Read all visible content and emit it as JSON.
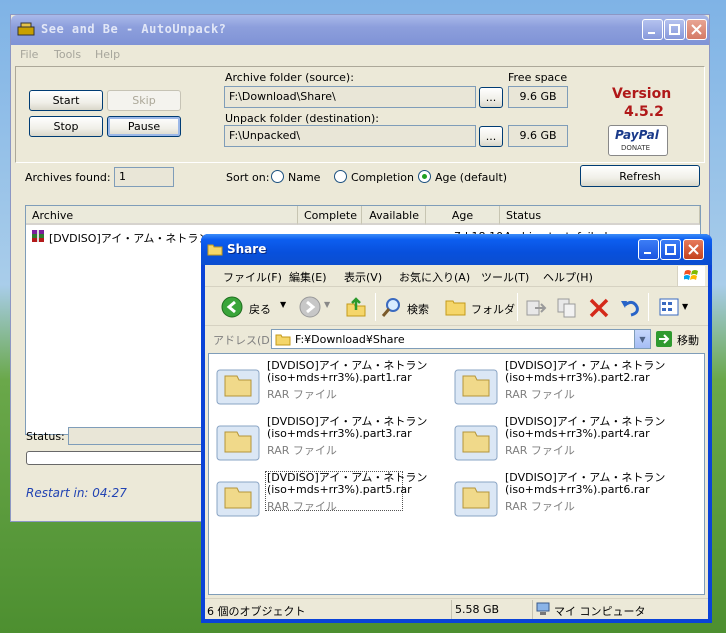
{
  "autounpack": {
    "title": "See and Be - AutoUnpack?",
    "menu": [
      "File",
      "Tools",
      "Help"
    ],
    "buttons": {
      "start": "Start",
      "skip": "Skip",
      "stop": "Stop",
      "pause": "Pause",
      "browse": "...",
      "refresh": "Refresh"
    },
    "archive_folder_label": "Archive folder (source):",
    "archive_folder_value": "F:\\Download\\Share\\",
    "unpack_folder_label": "Unpack folder (destination):",
    "unpack_folder_value": "F:\\Unpacked\\",
    "free_space_label": "Free space",
    "free_space_source": "9.6 GB",
    "free_space_dest": "9.6 GB",
    "version_label": "Version",
    "version_number": "4.5.2",
    "paypal_text": "PayPal",
    "paypal_donate": "DONATE",
    "archives_found_label": "Archives found:",
    "archives_found_value": "1",
    "sort_label": "Sort on:",
    "sort_options": [
      "Name",
      "Completion",
      "Age (default)"
    ],
    "sort_selected": "Age (default)",
    "columns": [
      "Archive",
      "Complete",
      "Available",
      "Age",
      "Status"
    ],
    "rows": [
      {
        "archive": "[DVDISO]アイ・アム・ネトラン(iso+mds+rr3%)",
        "complete": "",
        "available": "",
        "age": "7d 18:10",
        "status": "Archive test: failed"
      }
    ],
    "status_label": "Status:",
    "restart_text": "Restart in: 04:27"
  },
  "explorer": {
    "title": "Share",
    "menu": [
      "ファイル(F)",
      "編集(E)",
      "表示(V)",
      "お気に入り(A)",
      "ツール(T)",
      "ヘルプ(H)"
    ],
    "toolbar": {
      "back": "戻る",
      "search": "検索",
      "folders": "フォルダ"
    },
    "address_label": "アドレス(D)",
    "address_value": "F:¥Download¥Share",
    "go_label": "移動",
    "files": [
      {
        "line1": "[DVDISO]アイ・アム・ネトラン",
        "line2": "(iso+mds+rr3%).part1.rar",
        "type": "RAR ファイル"
      },
      {
        "line1": "[DVDISO]アイ・アム・ネトラン",
        "line2": "(iso+mds+rr3%).part2.rar",
        "type": "RAR ファイル"
      },
      {
        "line1": "[DVDISO]アイ・アム・ネトラン",
        "line2": "(iso+mds+rr3%).part3.rar",
        "type": "RAR ファイル"
      },
      {
        "line1": "[DVDISO]アイ・アム・ネトラン",
        "line2": "(iso+mds+rr3%).part4.rar",
        "type": "RAR ファイル"
      },
      {
        "line1": "[DVDISO]アイ・アム・ネトラン",
        "line2": "(iso+mds+rr3%).part5.rar",
        "type": "RAR ファイル"
      },
      {
        "line1": "[DVDISO]アイ・アム・ネトラン",
        "line2": "(iso+mds+rr3%).part6.rar",
        "type": "RAR ファイル"
      }
    ],
    "status_objects": "6 個のオブジェクト",
    "status_size": "5.58 GB",
    "status_location": "マイ コンピュータ"
  },
  "colors": {
    "xp_blue": "#0a43d8",
    "inactive_title": "#8d9fdc",
    "version_red": "#b01818",
    "restart_blue": "#2244b3"
  },
  "icons": [
    "app-icon",
    "minimize-icon",
    "maximize-icon",
    "close-icon",
    "rar-archive-icon",
    "folder-icon",
    "back-arrow-icon",
    "forward-arrow-icon",
    "up-folder-icon",
    "search-icon",
    "folders-icon",
    "move-to-icon",
    "copy-to-icon",
    "delete-icon",
    "undo-icon",
    "views-icon",
    "go-arrow-icon",
    "computer-icon",
    "windows-logo-icon"
  ]
}
